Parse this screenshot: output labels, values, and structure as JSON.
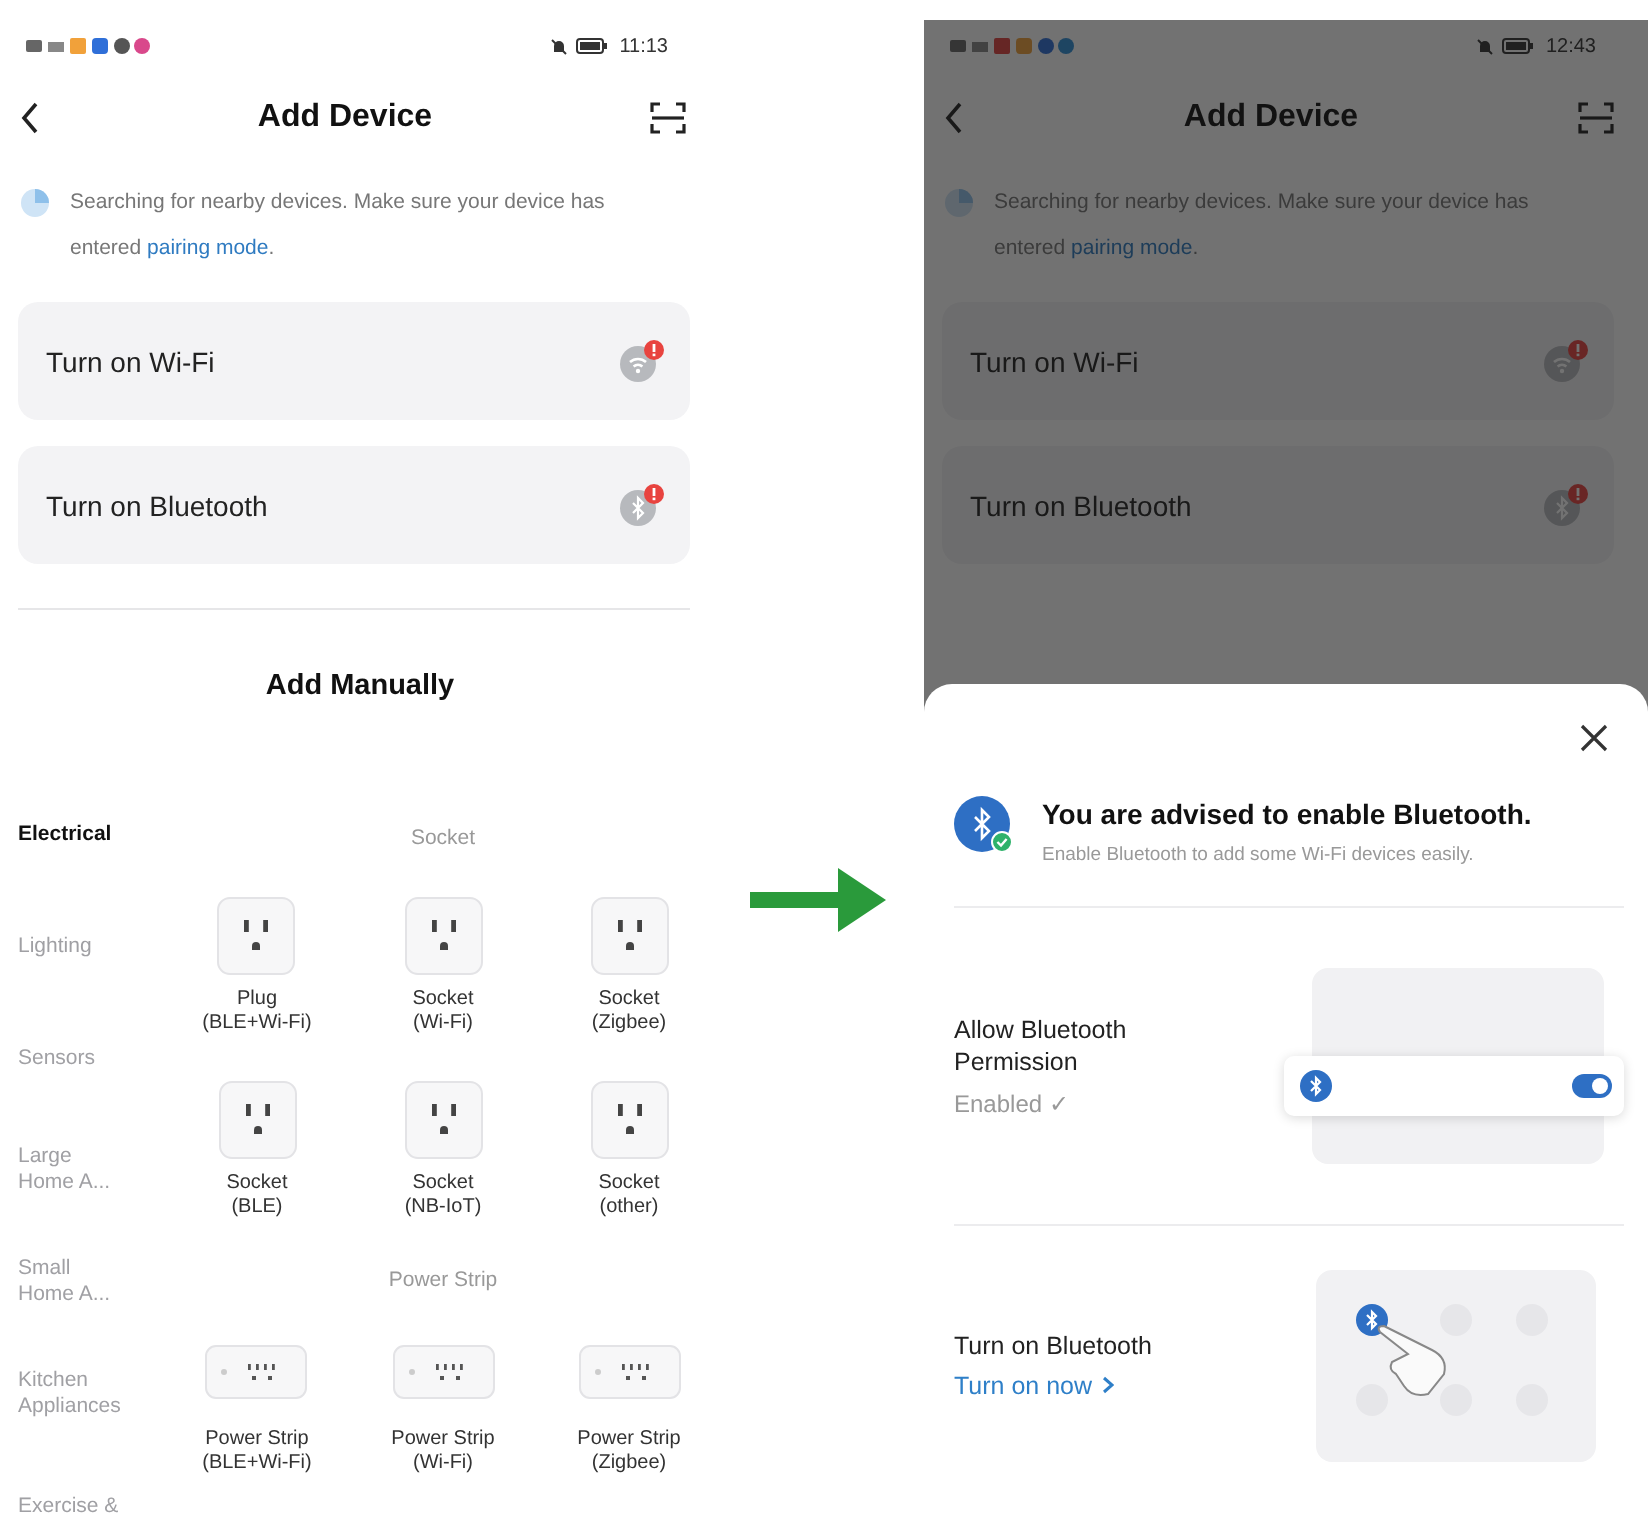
{
  "left_screen": {
    "status_bar": {
      "time": "11:13"
    },
    "header": {
      "title": "Add Device"
    },
    "notice": {
      "text": "Searching for nearby devices. Make sure your device has entered ",
      "link": "pairing mode",
      "end": "."
    },
    "prompts": [
      {
        "label": "Turn on Wi-Fi",
        "kind": "wifi"
      },
      {
        "label": "Turn on Bluetooth",
        "kind": "bluetooth"
      }
    ],
    "section_title": "Add Manually",
    "categories": [
      {
        "label": "Electrical",
        "selected": true
      },
      {
        "label": "Lighting",
        "selected": false
      },
      {
        "label": "Sensors",
        "selected": false
      },
      {
        "label": "Large\nHome A...",
        "selected": false
      },
      {
        "label": "Small\nHome A...",
        "selected": false
      },
      {
        "label": "Kitchen\nAppliances",
        "selected": false
      },
      {
        "label": "Exercise &",
        "selected": false
      }
    ],
    "groups": [
      {
        "title": "Socket",
        "devices": [
          {
            "name": "Plug\n(BLE+Wi-Fi)",
            "kind": "socket"
          },
          {
            "name": "Socket\n(Wi-Fi)",
            "kind": "socket"
          },
          {
            "name": "Socket\n(Zigbee)",
            "kind": "socket"
          },
          {
            "name": "Socket\n(BLE)",
            "kind": "socket"
          },
          {
            "name": "Socket\n(NB-IoT)",
            "kind": "socket"
          },
          {
            "name": "Socket\n(other)",
            "kind": "socket"
          }
        ]
      },
      {
        "title": "Power Strip",
        "devices": [
          {
            "name": "Power Strip\n(BLE+Wi-Fi)",
            "kind": "strip"
          },
          {
            "name": "Power Strip\n(Wi-Fi)",
            "kind": "strip"
          },
          {
            "name": "Power Strip\n(Zigbee)",
            "kind": "strip"
          }
        ]
      }
    ]
  },
  "right_screen": {
    "status_bar": {
      "time": "12:43"
    },
    "header": {
      "title": "Add Device"
    },
    "notice": {
      "text": "Searching for nearby devices. Make sure your device has entered ",
      "link": "pairing mode",
      "end": "."
    },
    "prompts": [
      {
        "label": "Turn on Wi-Fi",
        "kind": "wifi"
      },
      {
        "label": "Turn on Bluetooth",
        "kind": "bluetooth"
      }
    ],
    "sheet": {
      "title": "You are advised to enable Bluetooth.",
      "subtitle": "Enable Bluetooth to add some Wi-Fi devices easily.",
      "steps": [
        {
          "kind": "permission",
          "title": "Allow Bluetooth Permission",
          "status": "Enabled ✓",
          "toggle_on": true
        },
        {
          "kind": "control",
          "title": "Turn on Bluetooth",
          "link": "Turn on now"
        }
      ]
    }
  }
}
